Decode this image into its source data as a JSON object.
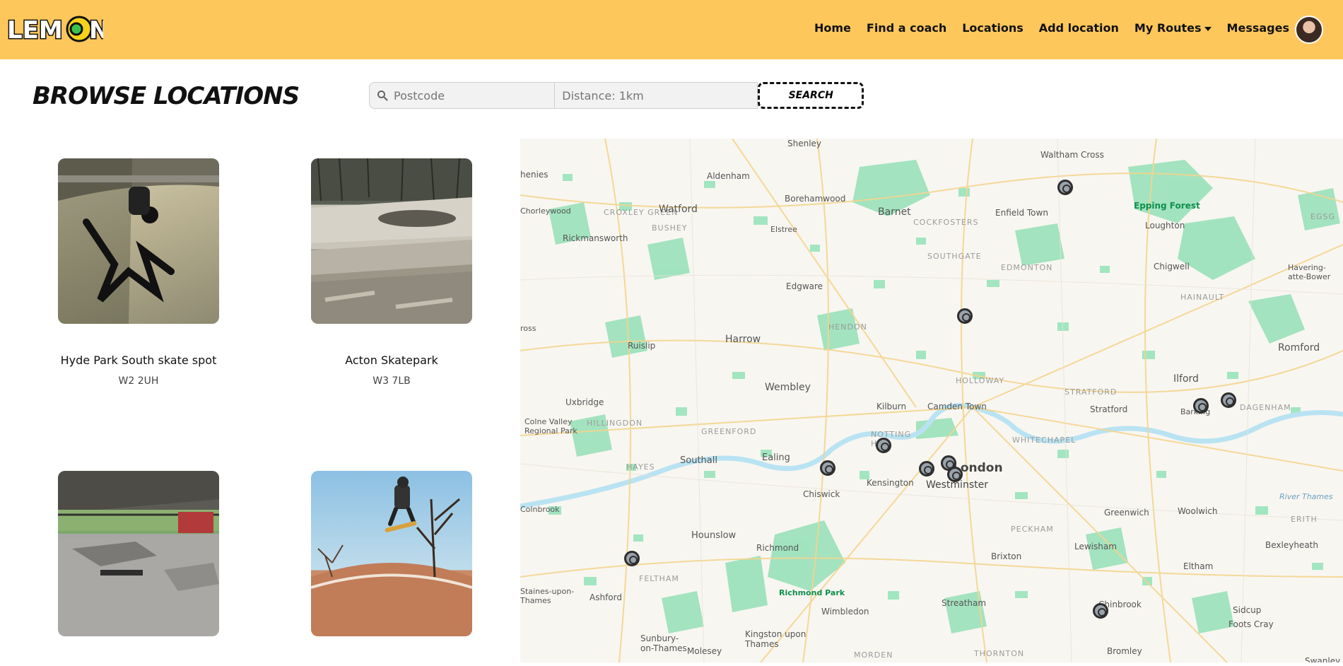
{
  "nav": {
    "logo_text": "LEMON",
    "links": [
      "Home",
      "Find a coach",
      "Locations",
      "Add location",
      "My Routes",
      "Messages"
    ]
  },
  "page": {
    "title": "BROWSE LOCATIONS"
  },
  "search": {
    "postcode_placeholder": "Postcode",
    "distance_placeholder": "Distance: 1km",
    "button_label": "SEARCH"
  },
  "locations": [
    {
      "name": "Hyde Park South skate spot",
      "postcode": "W2 2UH"
    },
    {
      "name": "Acton Skatepark",
      "postcode": "W3 7LB"
    },
    {
      "name": "",
      "postcode": ""
    },
    {
      "name": "",
      "postcode": ""
    }
  ],
  "map": {
    "labels": {
      "shenley": "Shenley",
      "waltham_cross": "Waltham Cross",
      "chenies": "henies",
      "aldenham": "Aldenham",
      "borehamwood": "Borehamwood",
      "epping_forest": "Epping Forest",
      "croxley_green": "CROXLEY GREEN",
      "watford": "Watford",
      "barnet": "Barnet",
      "enfield_town": "Enfield Town",
      "loughton": "Loughton",
      "egsg": "EGSG",
      "chorleywood": "Chorleywood",
      "bushey": "BUSHEY",
      "elstree": "Elstree",
      "cockfosters": "COCKFOSTERS",
      "rickmansworth": "Rickmansworth",
      "southgate": "SOUTHGATE",
      "chigwell": "Chigwell",
      "edgware": "Edgware",
      "edmonton": "EDMONTON",
      "havering": "Havering-atte-Bower",
      "hainault": "HAINAULT",
      "hendon": "HENDON",
      "cross": "ross",
      "harrow": "Harrow",
      "ruislip": "Ruislip",
      "romford": "Romford",
      "holloway": "HOLLOWAY",
      "ilford": "Ilford",
      "wembley": "Wembley",
      "stratford_area": "STRATFORD",
      "uxbridge": "Uxbridge",
      "kilburn": "Kilburn",
      "camden_town": "Camden Town",
      "stratford": "Stratford",
      "barking": "Barking",
      "dagenham": "DAGENHAM",
      "hillingdon": "HILLINGDON",
      "colne_valley": "Colne Valley Regional Park",
      "greenford": "GREENFORD",
      "notting_hill": "NOTTING HILL",
      "whitechapel": "WHITECHAPEL",
      "london": "London",
      "southall": "Southall",
      "ealing": "Ealing",
      "hayes": "HAYES",
      "kensington": "Kensington",
      "westminster": "Westminster",
      "chiswick": "Chiswick",
      "colnbrook": "Colnbrook",
      "river_thames": "River Thames",
      "greenwich": "Greenwich",
      "woolwich": "Woolwich",
      "erith": "ERITH",
      "peckham": "PECKHAM",
      "hounslow": "Hounslow",
      "richmond": "Richmond",
      "lewisham": "Lewisham",
      "bexleyheath": "Bexleyheath",
      "feltham": "FELTHAM",
      "brixton": "Brixton",
      "eltham": "Eltham",
      "richmond_park": "Richmond Park",
      "staines": "Staines-upon-Thames",
      "ashford": "Ashford",
      "streatham": "Streatham",
      "chinbrook": "Chinbrook",
      "wimbledon": "Wimbledon",
      "sidcup": "Sidcup",
      "foots_cray": "Foots Cray",
      "kingston": "Kingston upon Thames",
      "sunbury": "Sunbury-on-Thames",
      "molesey": "Molesey",
      "morden": "MORDEN",
      "thornton": "THORNTON",
      "bromley": "Bromley",
      "swanley": "Swanley"
    }
  }
}
